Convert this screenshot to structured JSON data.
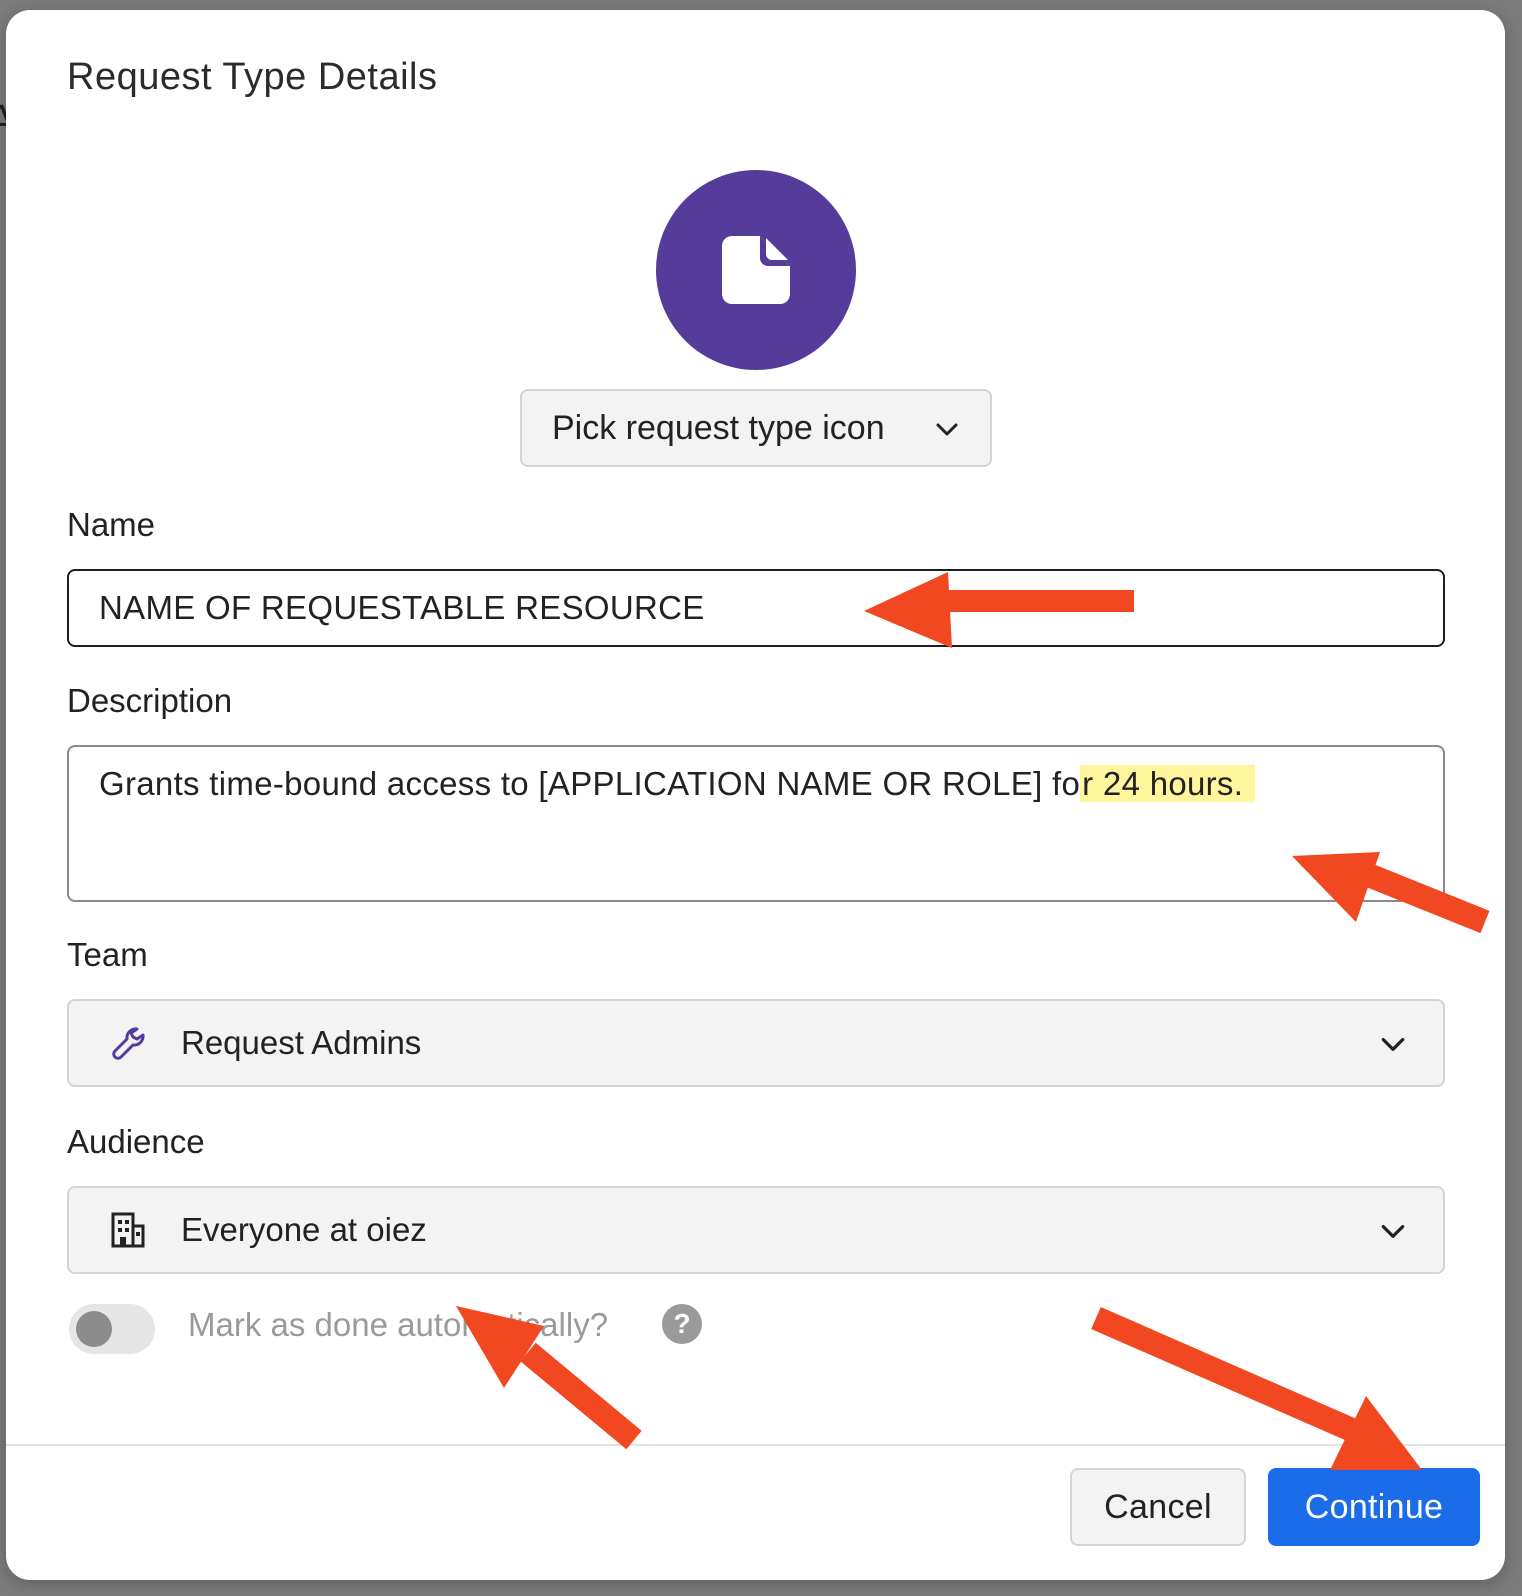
{
  "modal": {
    "title": "Request Type Details",
    "icon_name": "document-icon",
    "icon_color": "#553c9a",
    "pick_icon_label": "Pick request type icon"
  },
  "name": {
    "label": "Name",
    "value": "NAME OF REQUESTABLE RESOURCE"
  },
  "description": {
    "label": "Description",
    "value_main": "Grants time-bound access to [APPLICATION NAME OR ROLE] fo",
    "value_highlight": "r 24 hours.",
    "highlight_color": "#fff59d"
  },
  "team": {
    "label": "Team",
    "icon_name": "wrench-icon",
    "value": "Request Admins"
  },
  "audience": {
    "label": "Audience",
    "icon_name": "building-icon",
    "value": "Everyone at oiez"
  },
  "auto_done": {
    "label": "Mark as done automatically?",
    "enabled": false,
    "help": "?"
  },
  "footer": {
    "cancel_label": "Cancel",
    "continue_label": "Continue",
    "continue_color": "#1a6ce8"
  },
  "annotations": {
    "arrow_color": "#f24822",
    "arrow_count": 4
  }
}
